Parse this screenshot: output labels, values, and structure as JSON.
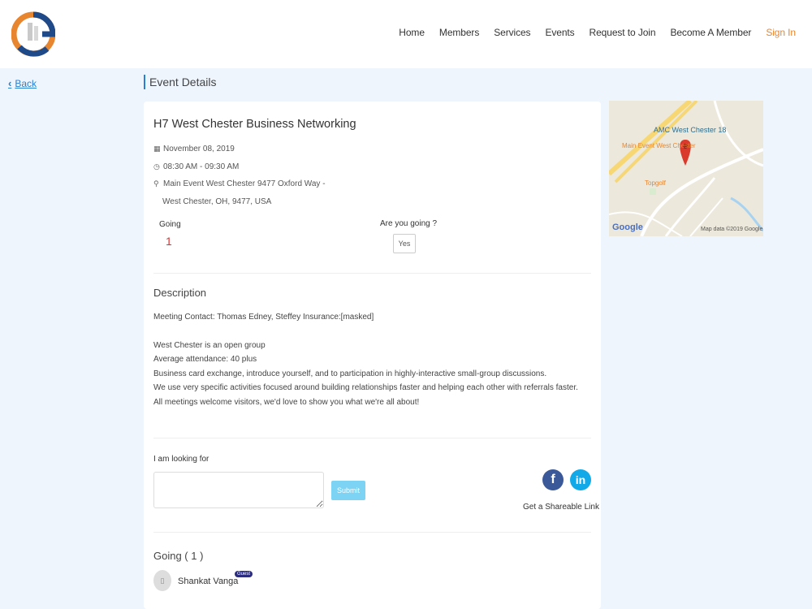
{
  "nav": {
    "items": [
      "Home",
      "Members",
      "Services",
      "Events",
      "Request to Join",
      "Become A Member"
    ],
    "signin": "Sign In"
  },
  "back_label": "Back",
  "section_title": "Event Details",
  "event": {
    "title": "H7 West Chester Business Networking",
    "date": "November 08, 2019",
    "time": "08:30 AM - 09:30 AM",
    "address1": "Main Event West Chester 9477 Oxford Way -",
    "address2": "West Chester, OH, 9477, USA"
  },
  "rsvp": {
    "going_label": "Going",
    "going_count": "1",
    "question": "Are you going ?",
    "yes_label": "Yes"
  },
  "description": {
    "title": "Description",
    "lines": [
      "Meeting Contact: Thomas Edney, Steffey Insurance:[masked]",
      "",
      "West Chester is an open group",
      "Average attendance: 40 plus",
      "Business card exchange, introduce yourself, and to participation in highly-interactive small-group discussions.",
      "We use very specific activities focused around building relationships faster and helping each other with referrals faster.",
      "All meetings welcome visitors, we'd love to show you what we're all about!"
    ]
  },
  "looking": {
    "label": "I am looking for",
    "placeholder": "",
    "submit": "Submit"
  },
  "share": {
    "fb": "f",
    "li": "in",
    "label": "Get a Shareable Link"
  },
  "attendees": {
    "title": "Going ( 1 )",
    "members": [
      {
        "name": "Shankat Vanga",
        "badge": "Guest"
      }
    ]
  },
  "map": {
    "amc": "AMC West Chester 18",
    "mainevent": "Main Event West Chester",
    "topgolf": "Topgolf",
    "google": "Google",
    "mapdata": "Map data ©2019 Google"
  },
  "colors": {
    "accent": "#2a7fd3",
    "signin": "#e8862f",
    "going_count": "#dd3333",
    "submit": "#7cd3f3",
    "facebook": "#3b5998",
    "linkedin": "#12a9e9"
  }
}
